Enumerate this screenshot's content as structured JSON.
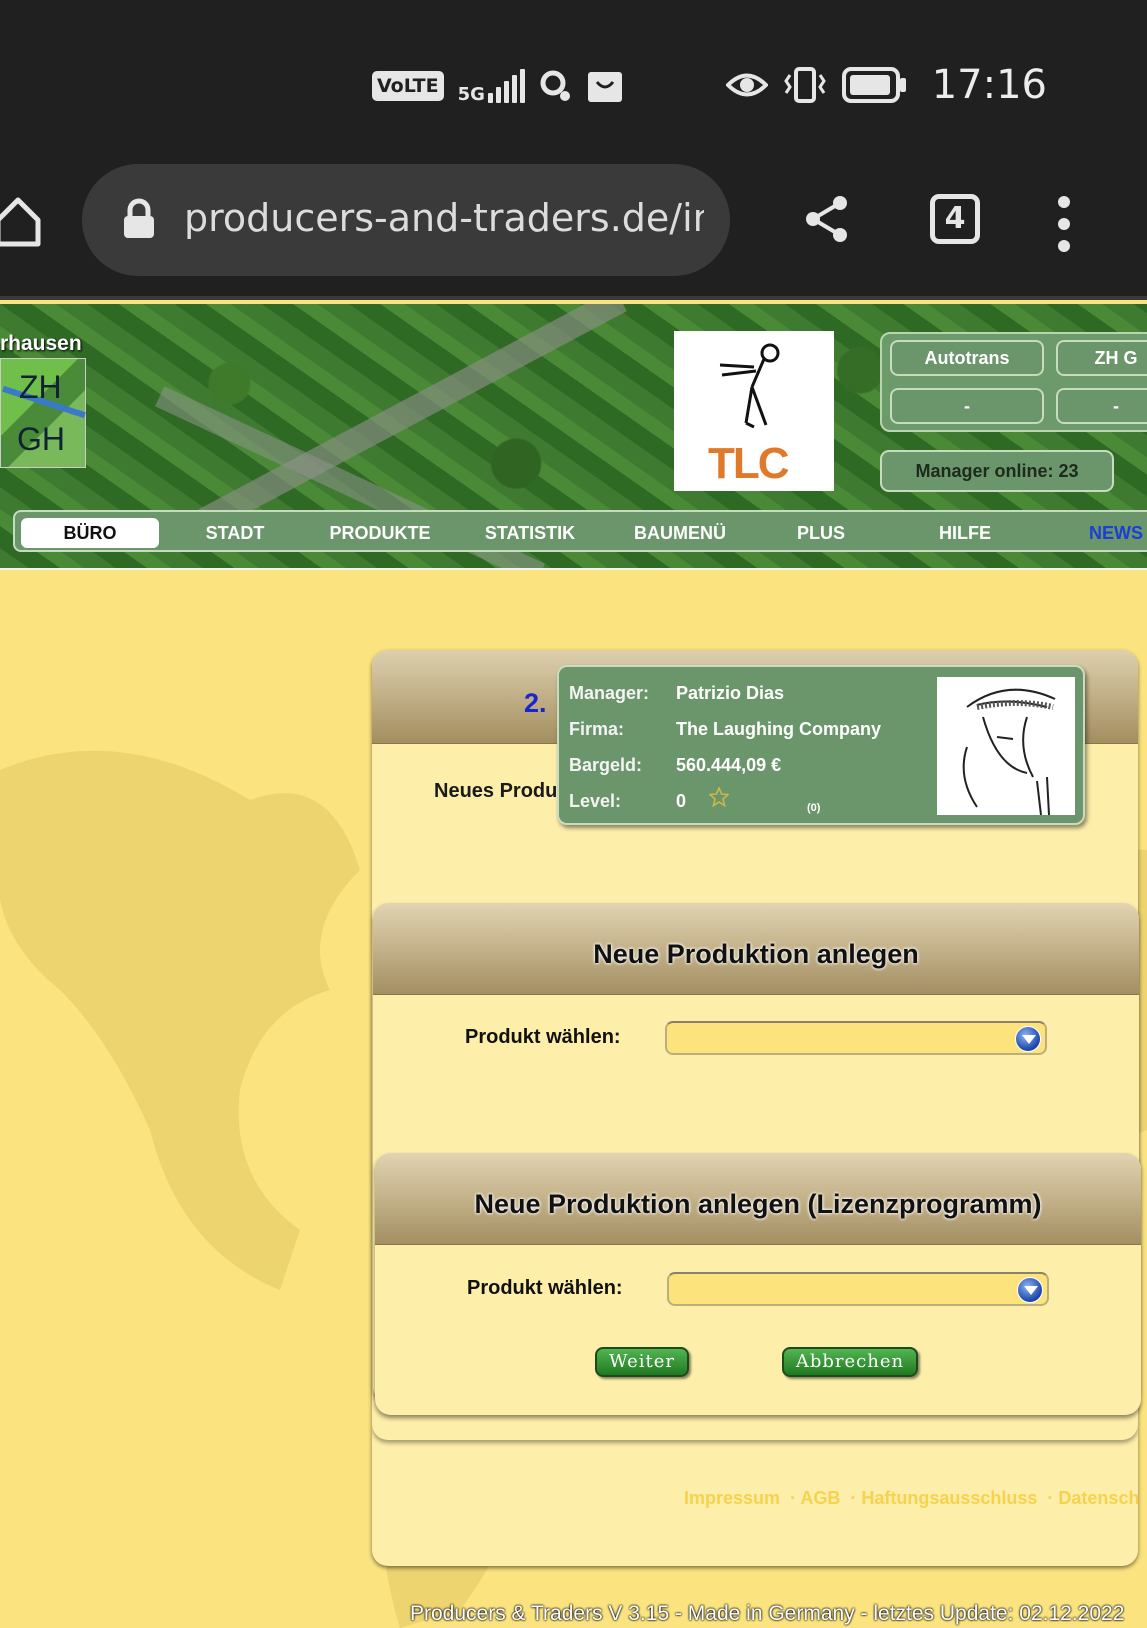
{
  "statusbar": {
    "volte": "VoLTE",
    "network": "5G",
    "time": "17:16",
    "icons": [
      "volte-icon",
      "signal-icon",
      "search-icon",
      "shop-icon",
      "eye-icon",
      "vibrate-icon",
      "battery-icon"
    ]
  },
  "browser": {
    "url": "producers-and-traders.de/index",
    "tab_count": "4"
  },
  "header": {
    "city_name": "rhausen",
    "map_labels": {
      "top": "ZH",
      "bottom": "GH"
    },
    "logo_text": "TLC",
    "companies": [
      {
        "name": "Autotrans",
        "value": "-"
      },
      {
        "name": "ZH G",
        "value": "-"
      }
    ],
    "manager_online_label": "Manager online:",
    "manager_online_count": "23"
  },
  "nav": {
    "items": [
      {
        "label": "BÜRO",
        "active": true
      },
      {
        "label": "STADT"
      },
      {
        "label": "PRODUKTE"
      },
      {
        "label": "STATISTIK"
      },
      {
        "label": "BAUMENÜ"
      },
      {
        "label": "PLUS"
      },
      {
        "label": "HILFE"
      },
      {
        "label": "NEWS"
      }
    ]
  },
  "outer_panel": {
    "step_number": "2.",
    "subtitle": "Neues Produ"
  },
  "info_card": {
    "manager_label": "Manager:",
    "manager_value": "Patrizio Dias",
    "firma_label": "Firma:",
    "firma_value": "The Laughing Company",
    "bargeld_label": "Bargeld:",
    "bargeld_value": "560.444,09 €",
    "level_label": "Level:",
    "level_value": "0",
    "level_count": "(0)"
  },
  "panel_neue_produktion": {
    "title": "Neue Produktion anlegen",
    "field_label": "Produkt wählen:",
    "select_value": ""
  },
  "panel_lizenz": {
    "title": "Neue Produktion anlegen (Lizenzprogramm)",
    "field_label": "Produkt wählen:",
    "select_value": "",
    "weiter_label": "Weiter",
    "abbrechen_label": "Abbrechen"
  },
  "footer": {
    "links": [
      "Impressum",
      "AGB",
      "Haftungsausschluss",
      "Datenschutz"
    ],
    "version": "Producers & Traders V 3.15 - Made in Germany - letztes Update: 02.12.2022"
  },
  "colors": {
    "page_bg": "#fbe480",
    "nav_green": "#6b956a",
    "panel_header": "#a48f62",
    "button_green": "#2f8f2f",
    "link_blue": "#1a25d0"
  }
}
